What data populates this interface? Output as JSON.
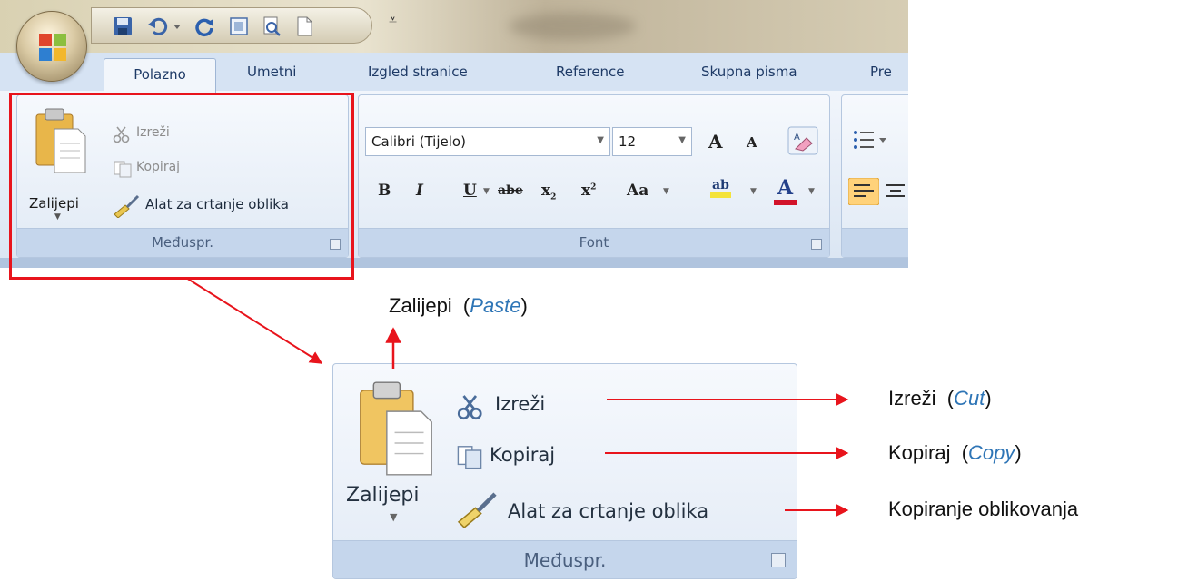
{
  "ribbon": {
    "tabs": [
      "Polazno",
      "Umetni",
      "Izgled stranice",
      "Reference",
      "Skupna pisma",
      "Pre"
    ],
    "clipboard": {
      "paste": "Zalijepi",
      "cut": "Izreži",
      "copy": "Kopiraj",
      "format_painter": "Alat za crtanje oblika",
      "group": "Međuspr."
    },
    "font": {
      "name": "Calibri (Tijelo)",
      "size": "12",
      "group": "Font",
      "buttons": {
        "bold": "B",
        "italic": "I",
        "underline": "U",
        "strike": "abe",
        "sub": "x",
        "sup": "x",
        "case": "Aa",
        "grow": "A",
        "shrink": "A",
        "highlight": "ab",
        "color": "A"
      }
    }
  },
  "zoom": {
    "paste": "Zalijepi",
    "cut": "Izreži",
    "copy": "Kopiraj",
    "format_painter": "Alat za crtanje oblika",
    "group": "Međuspr."
  },
  "annotations": {
    "paste": {
      "label": "Zalijepi",
      "english": "Paste"
    },
    "cut": {
      "label": "Izreži",
      "english": "Cut"
    },
    "copy": {
      "label": "Kopiraj",
      "english": "Copy"
    },
    "format_painter": {
      "label": "Kopiranje oblikovanja"
    }
  },
  "colors": {
    "highlight_red": "#e8141c",
    "english_blue": "#2e75b6",
    "arrow_red": "#e8141c"
  }
}
